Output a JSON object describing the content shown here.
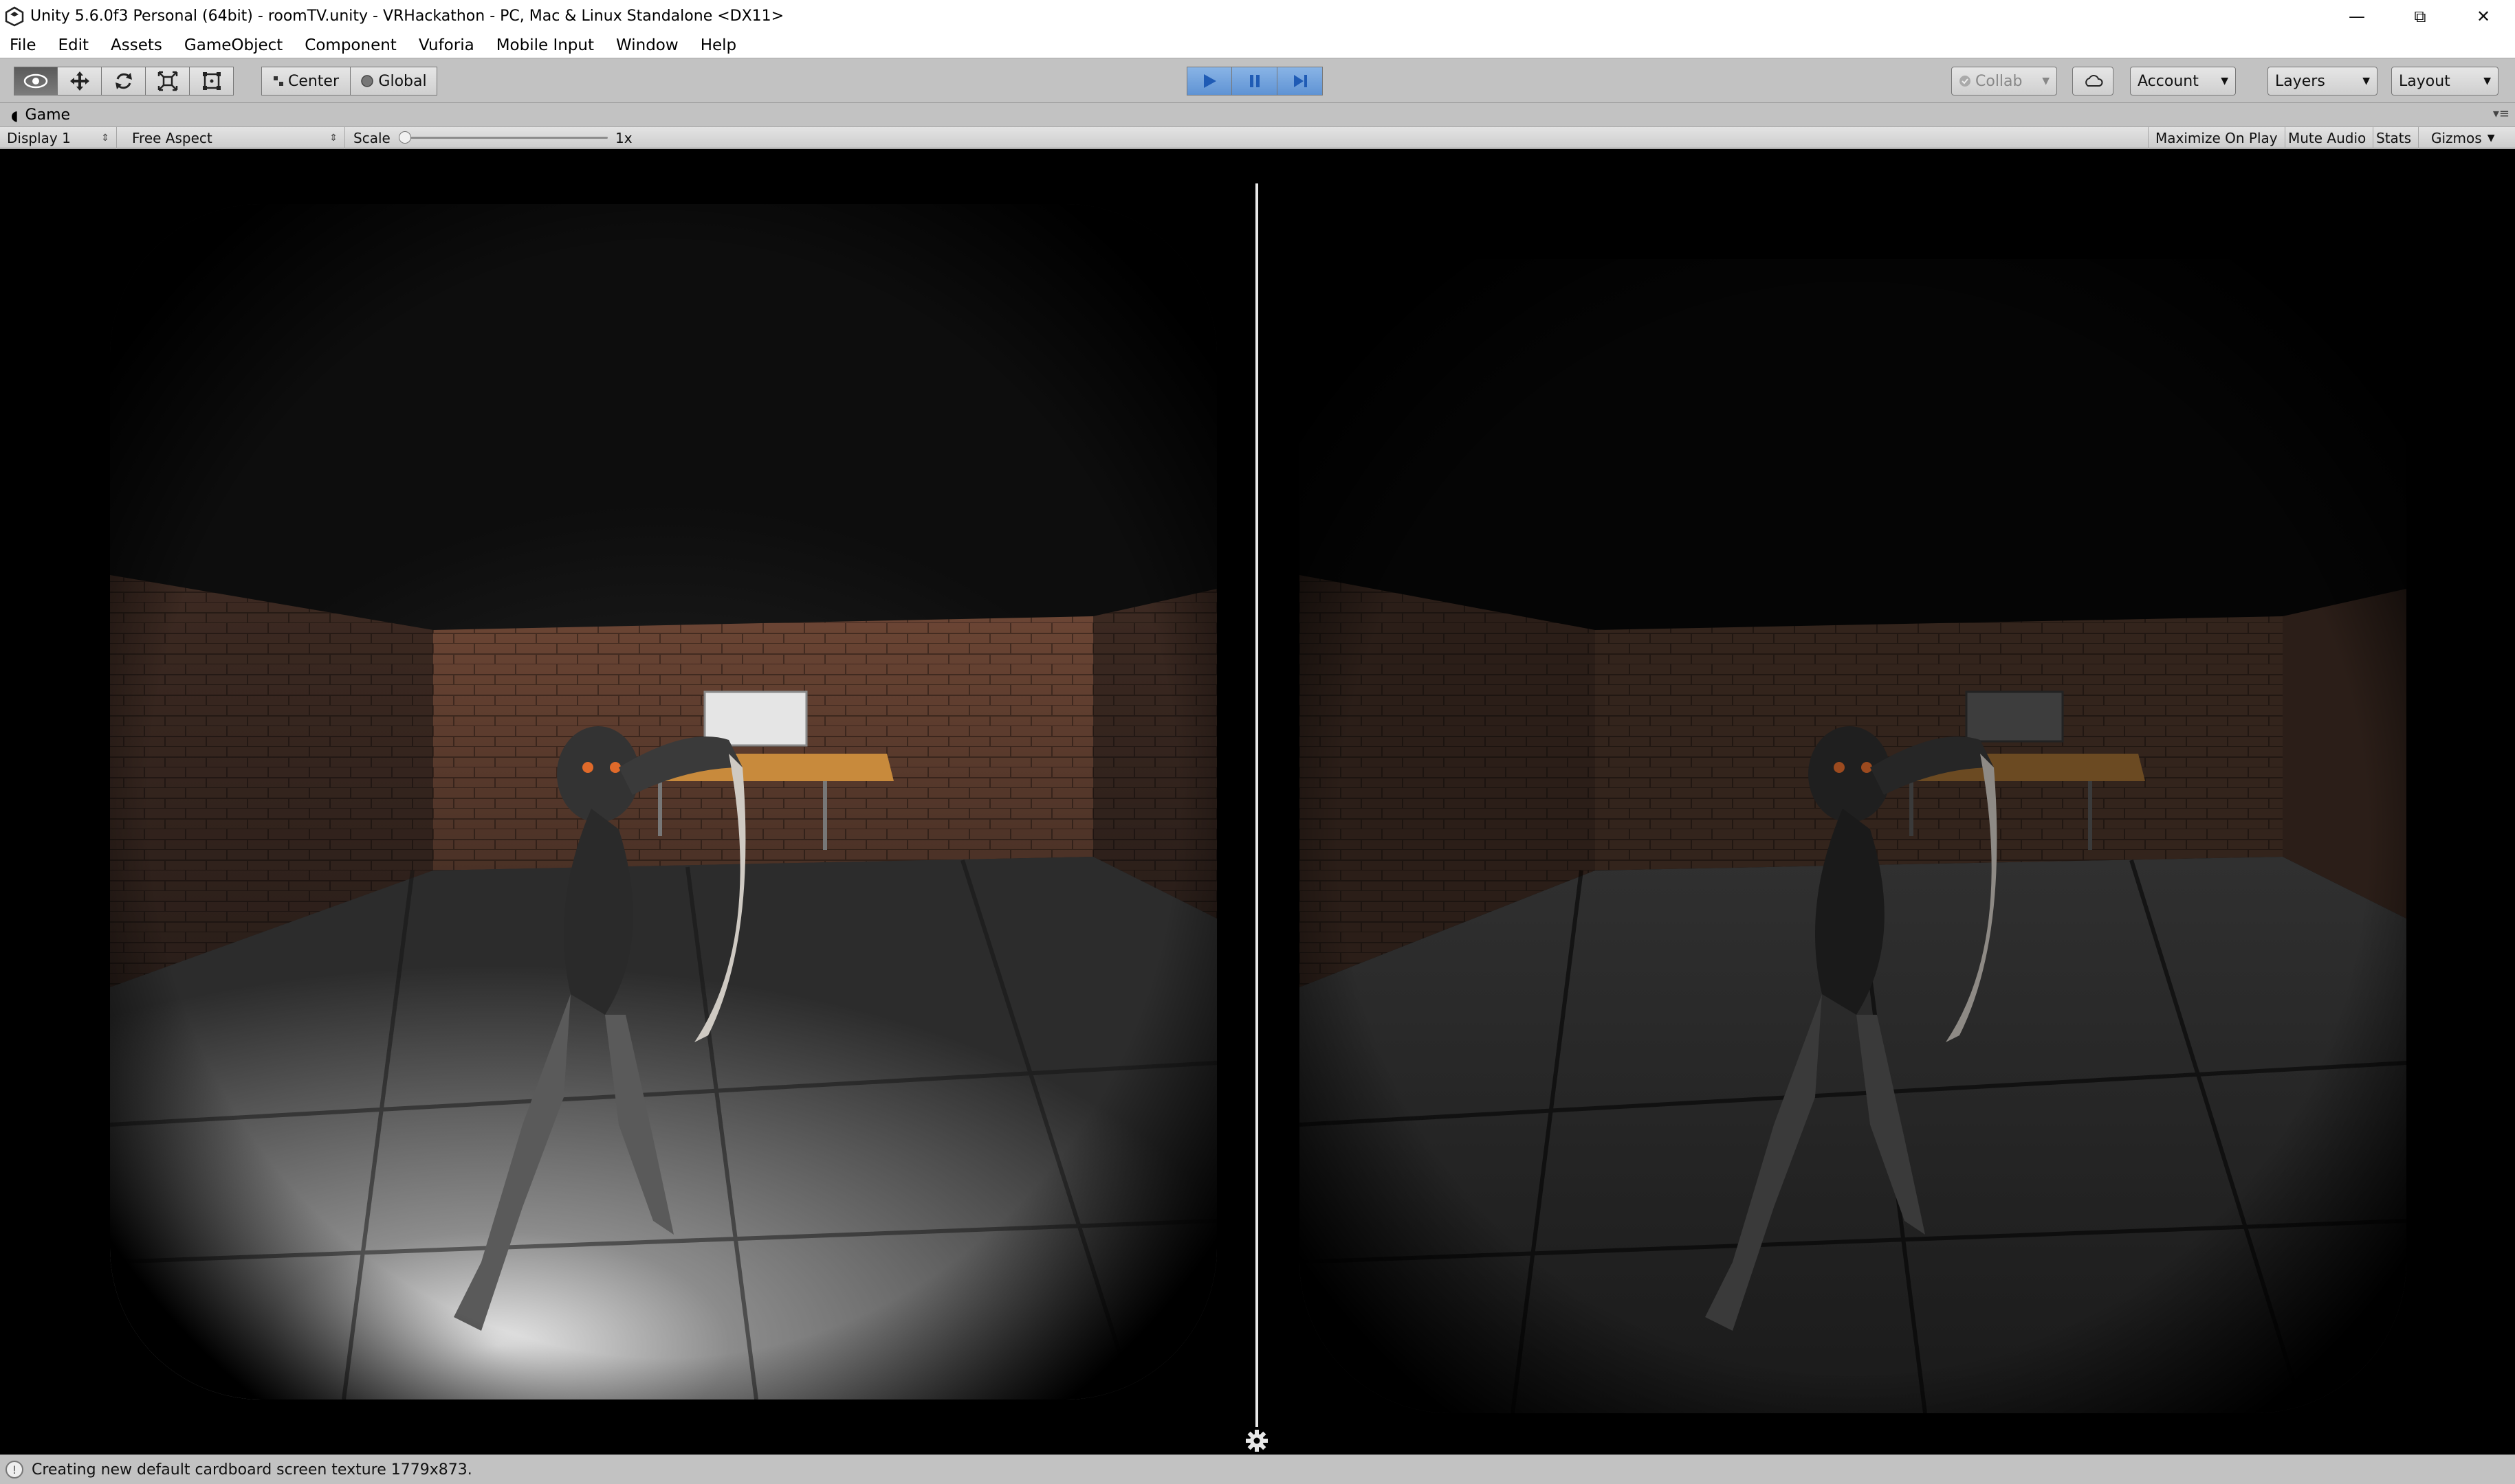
{
  "window": {
    "title": "Unity 5.6.0f3 Personal (64bit) - roomTV.unity - VRHackathon - PC, Mac & Linux Standalone <DX11>",
    "controls": {
      "minimize": "—",
      "restore": "⧉",
      "close": "✕"
    }
  },
  "menu": {
    "items": [
      "File",
      "Edit",
      "Assets",
      "GameObject",
      "Component",
      "Vuforia",
      "Mobile Input",
      "Window",
      "Help"
    ]
  },
  "toolbar": {
    "tools": [
      {
        "name": "hand-tool",
        "icon": "eye-icon",
        "active": true
      },
      {
        "name": "move-tool",
        "icon": "move-icon",
        "active": false
      },
      {
        "name": "rotate-tool",
        "icon": "rotate-icon",
        "active": false
      },
      {
        "name": "scale-tool",
        "icon": "scale-icon",
        "active": false
      },
      {
        "name": "rect-tool",
        "icon": "rect-icon",
        "active": false
      }
    ],
    "pivot_label": "Center",
    "space_label": "Global",
    "collab_label": "Collab",
    "account_label": "Account",
    "layers_label": "Layers",
    "layout_label": "Layout",
    "playback": {
      "play_active": true,
      "pause_active": true,
      "step_active": false
    }
  },
  "game_tab": {
    "label": "Game",
    "icon": "game-icon"
  },
  "game_toolbar": {
    "display": "Display 1",
    "aspect": "Free Aspect",
    "scale_label": "Scale",
    "scale_value": "1x",
    "scale_fraction": 0.0,
    "maximize_on_play": "Maximize On Play",
    "mute_audio": "Mute Audio",
    "stats": "Stats",
    "gizmos": "Gizmos"
  },
  "viewport": {
    "left_eye_brightness": "bright",
    "right_eye_brightness": "dim",
    "settings_icon": "gear-icon"
  },
  "status": {
    "message": "Creating new default cardboard screen texture 1779x873.",
    "icon": "info-icon"
  },
  "colors": {
    "editor_bg": "#c2c2c2",
    "play_blue": "#5f93d4",
    "viewport_bg": "#000000",
    "brick": "#5a3a2a",
    "table": "#c88a3c"
  }
}
